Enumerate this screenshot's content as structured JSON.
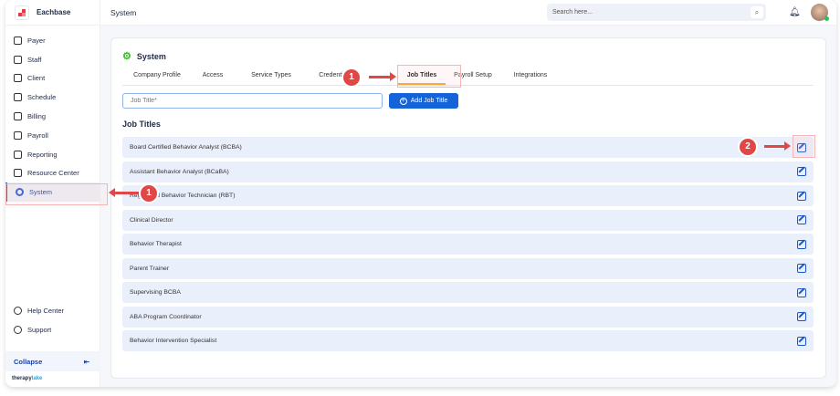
{
  "app": {
    "name": "Eachbase",
    "brand_a": "therapy",
    "brand_b": "lake"
  },
  "header": {
    "title": "System",
    "search_placeholder": "Search here..."
  },
  "sidebar": {
    "items": [
      {
        "label": "Payer"
      },
      {
        "label": "Staff"
      },
      {
        "label": "Client"
      },
      {
        "label": "Schedule"
      },
      {
        "label": "Billing"
      },
      {
        "label": "Payroll"
      },
      {
        "label": "Reporting"
      },
      {
        "label": "Resource Center"
      },
      {
        "label": "System"
      }
    ],
    "bottom": [
      {
        "label": "Help Center"
      },
      {
        "label": "Support"
      }
    ],
    "collapse": "Collapse"
  },
  "page": {
    "title": "System",
    "tabs": [
      {
        "label": "Company Profile"
      },
      {
        "label": "Access"
      },
      {
        "label": "Service Types"
      },
      {
        "label": "Credentials"
      },
      {
        "label": "Job Titles"
      },
      {
        "label": "Payroll Setup"
      },
      {
        "label": "Integrations"
      }
    ],
    "active_tab": "Job Titles",
    "input_placeholder": "Job Title*",
    "add_button": "Add Job Title",
    "section_title": "Job Titles",
    "job_titles": [
      "Board Certified Behavior Analyst (BCBA)",
      "Assistant Behavior Analyst (BCaBA)",
      "Registered Behavior Technician (RBT)",
      "Clinical Director",
      "Behavior Therapist",
      "Parent Trainer",
      "Supervising BCBA",
      "ABA Program Coordinator",
      "Behavior Intervention Specialist"
    ]
  },
  "annotations": {
    "step1": "1",
    "step2": "2"
  }
}
